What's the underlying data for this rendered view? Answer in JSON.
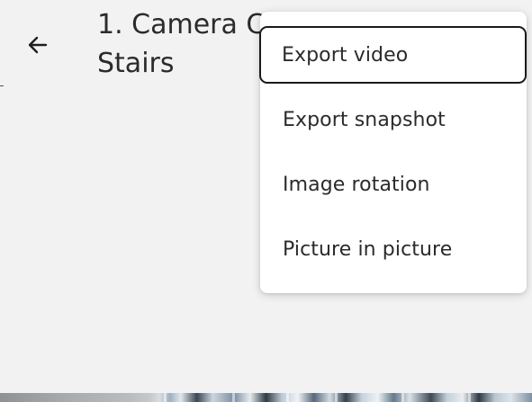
{
  "header": {
    "back_icon": "arrow-left-icon",
    "title_line1": "1. Camera C",
    "title_line2": "Stairs"
  },
  "menu": {
    "items": [
      {
        "label": "Export video",
        "focused": true
      },
      {
        "label": "Export snapshot",
        "focused": false
      },
      {
        "label": "Image rotation",
        "focused": false
      },
      {
        "label": "Picture in picture",
        "focused": false
      }
    ]
  },
  "colors": {
    "background": "#f2f2f2",
    "menu_background": "#ffffff",
    "text": "#2b2b2b",
    "focus_outline": "#1a1a1a"
  }
}
